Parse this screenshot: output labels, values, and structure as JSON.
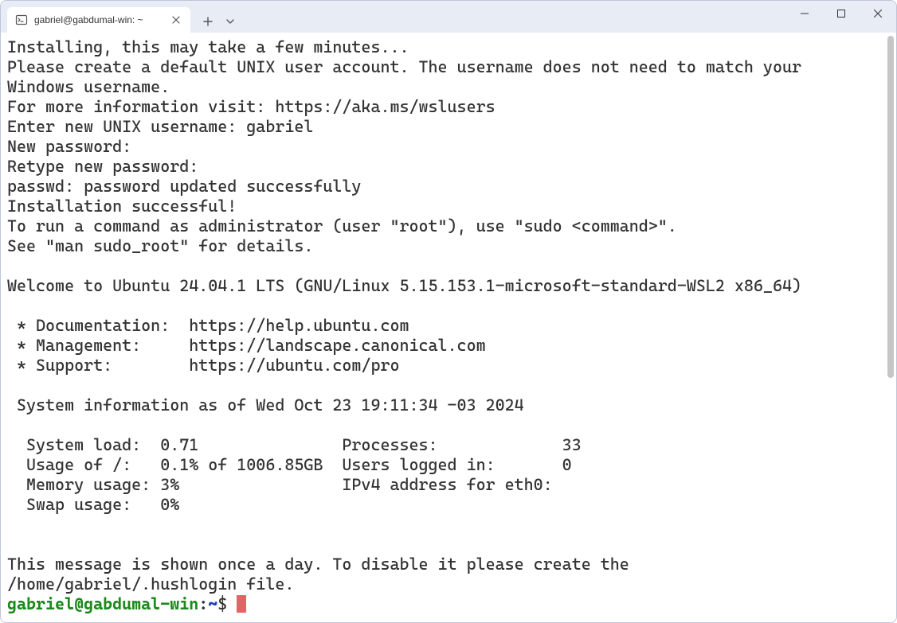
{
  "tab": {
    "title": "gabriel@gabdumal-win: ~"
  },
  "terminal": {
    "lines": [
      "Installing, this may take a few minutes...",
      "Please create a default UNIX user account. The username does not need to match your",
      "Windows username.",
      "For more information visit: https://aka.ms/wslusers",
      "Enter new UNIX username: gabriel",
      "New password:",
      "Retype new password:",
      "passwd: password updated successfully",
      "Installation successful!",
      "To run a command as administrator (user \"root\"), use \"sudo <command>\".",
      "See \"man sudo_root\" for details.",
      "",
      "Welcome to Ubuntu 24.04.1 LTS (GNU/Linux 5.15.153.1-microsoft-standard-WSL2 x86_64)",
      "",
      " * Documentation:  https://help.ubuntu.com",
      " * Management:     https://landscape.canonical.com",
      " * Support:        https://ubuntu.com/pro",
      "",
      " System information as of Wed Oct 23 19:11:34 -03 2024",
      "",
      "  System load:  0.71               Processes:             33",
      "  Usage of /:   0.1% of 1006.85GB  Users logged in:       0",
      "  Memory usage: 3%                 IPv4 address for eth0:",
      "  Swap usage:   0%",
      "",
      "",
      "This message is shown once a day. To disable it please create the",
      "/home/gabriel/.hushlogin file."
    ],
    "prompt": {
      "user_host": "gabriel@gabdumal-win",
      "separator": ":",
      "path": "~",
      "symbol": "$"
    }
  }
}
